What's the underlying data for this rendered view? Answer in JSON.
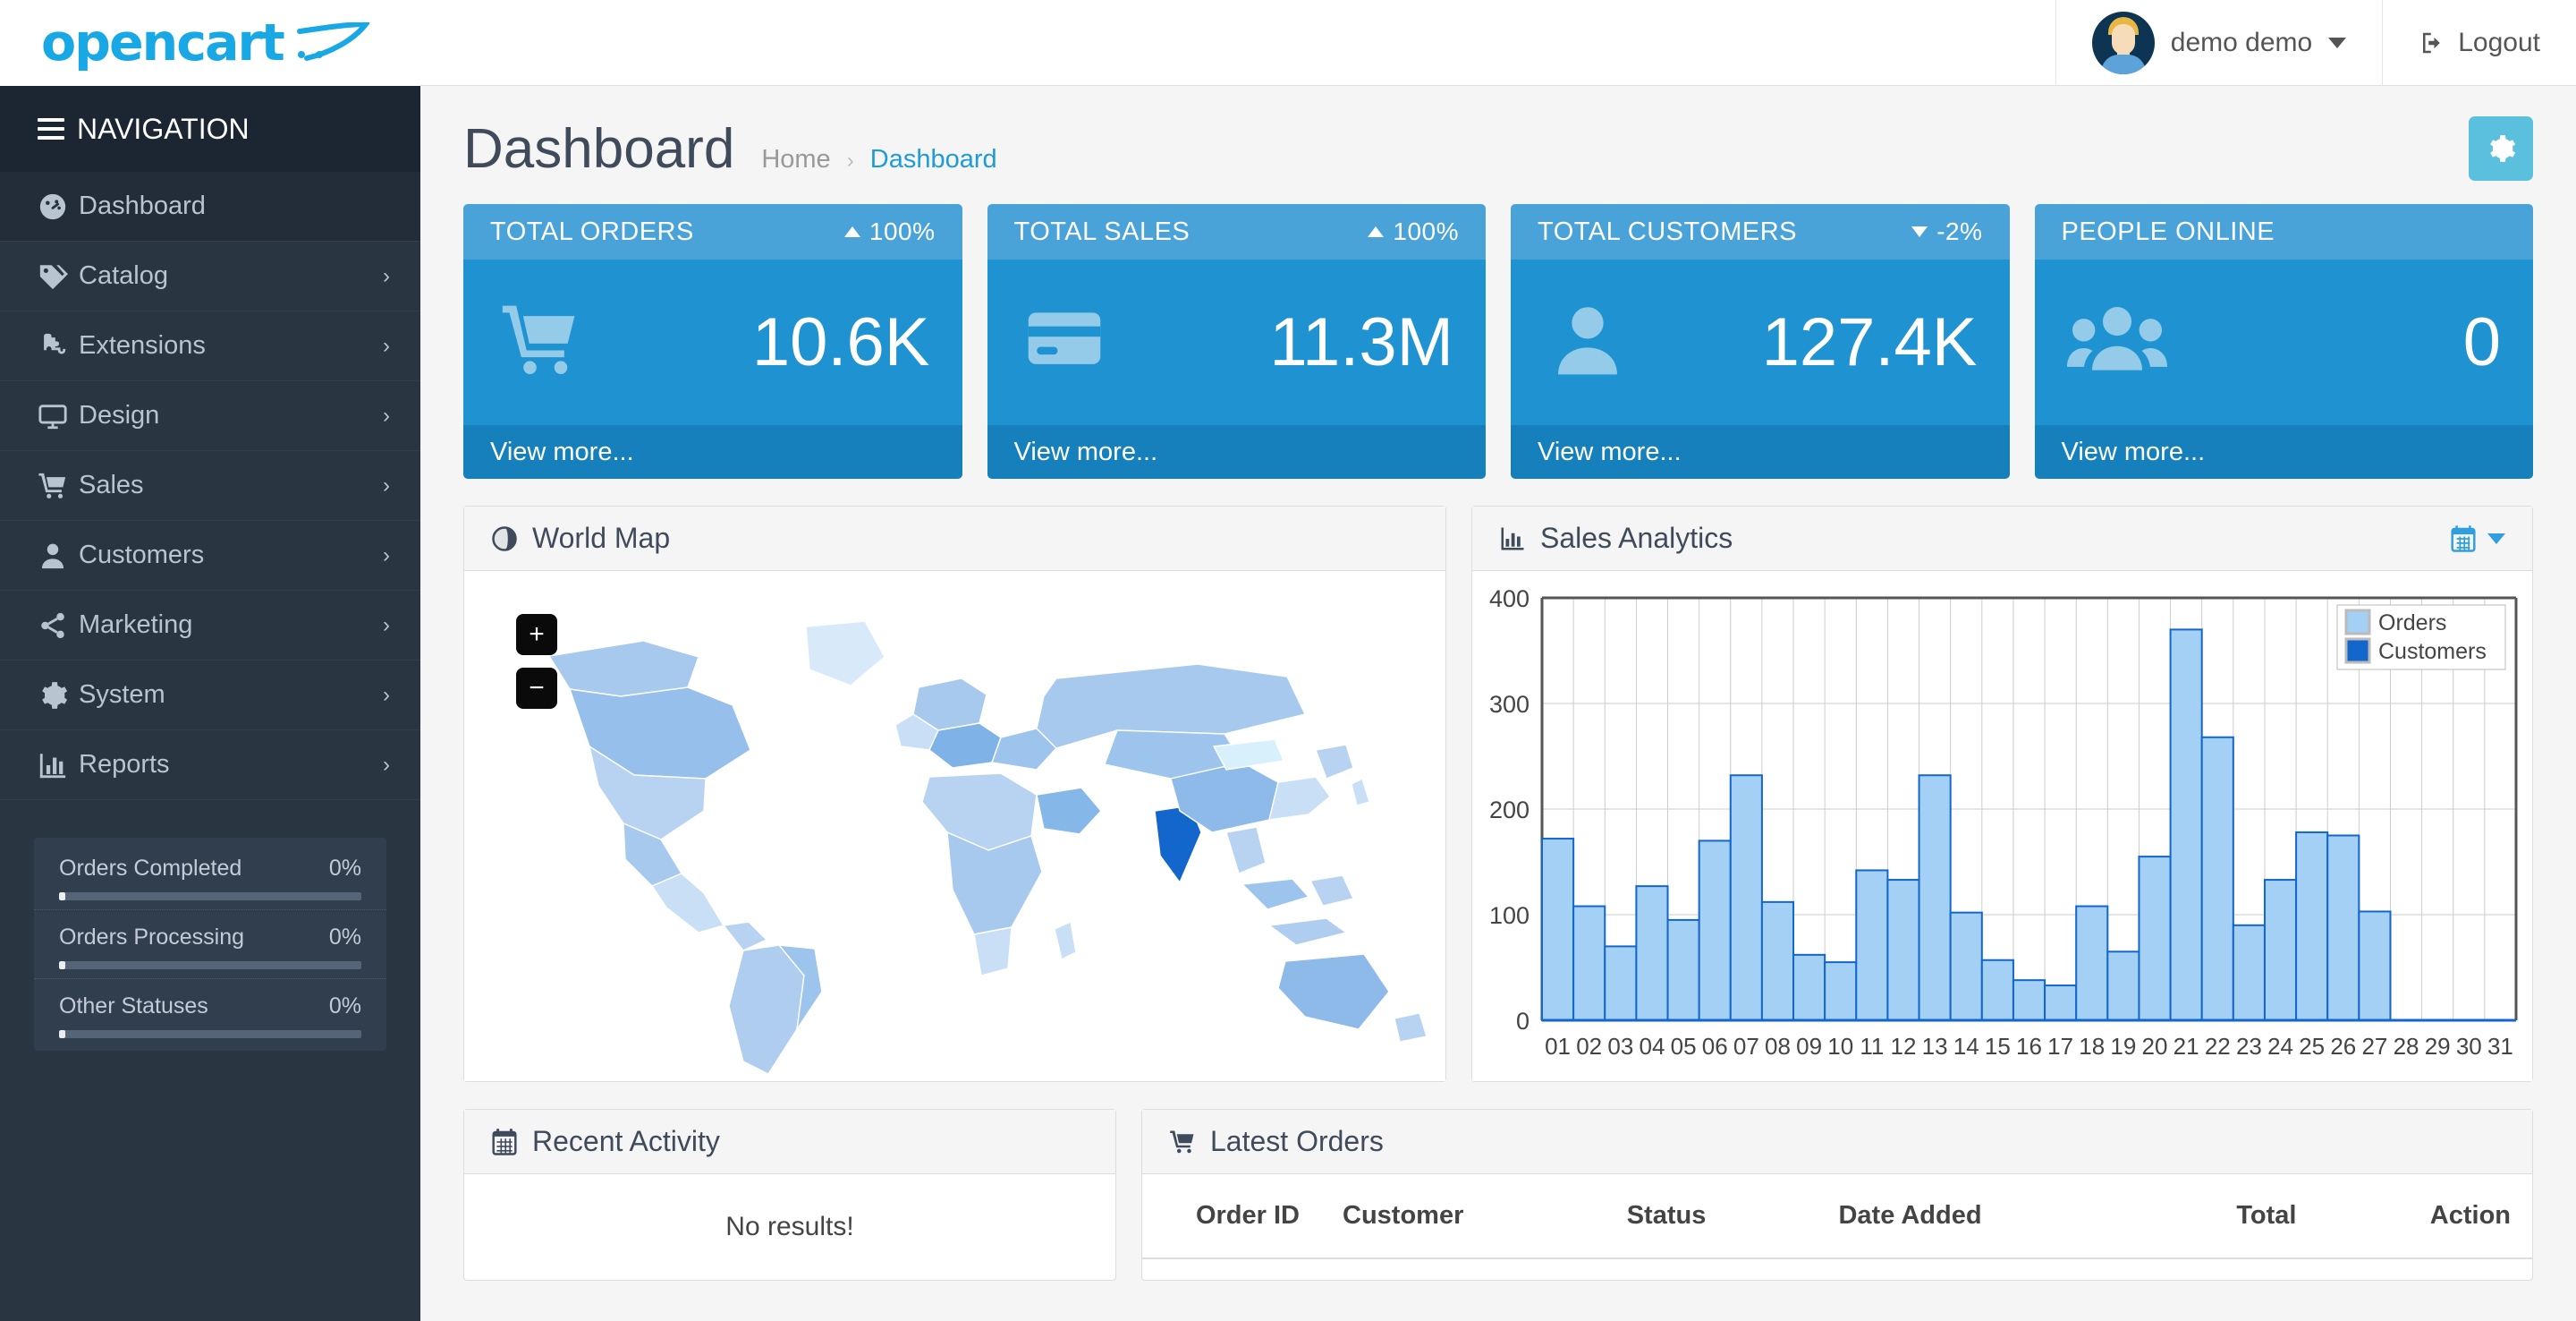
{
  "brand": {
    "logo_text": "opencart",
    "logo_icon": "shopping-cart-swoosh"
  },
  "sidebar": {
    "nav_header": "NAVIGATION",
    "items": [
      {
        "label": "Dashboard",
        "icon": "dashboard-gauge-icon",
        "has_caret": false,
        "active": true
      },
      {
        "label": "Catalog",
        "icon": "tag-icon",
        "has_caret": true,
        "active": false
      },
      {
        "label": "Extensions",
        "icon": "puzzle-piece-icon",
        "has_caret": true,
        "active": false
      },
      {
        "label": "Design",
        "icon": "monitor-icon",
        "has_caret": true,
        "active": false
      },
      {
        "label": "Sales",
        "icon": "shopping-cart-icon",
        "has_caret": true,
        "active": false
      },
      {
        "label": "Customers",
        "icon": "user-icon",
        "has_caret": true,
        "active": false
      },
      {
        "label": "Marketing",
        "icon": "share-nodes-icon",
        "has_caret": true,
        "active": false
      },
      {
        "label": "System",
        "icon": "gear-icon",
        "has_caret": true,
        "active": false
      },
      {
        "label": "Reports",
        "icon": "bar-chart-icon",
        "has_caret": true,
        "active": false
      }
    ],
    "stats": [
      {
        "label": "Orders Completed",
        "value": "0%",
        "percent": 0
      },
      {
        "label": "Orders Processing",
        "value": "0%",
        "percent": 0
      },
      {
        "label": "Other Statuses",
        "value": "0%",
        "percent": 0
      }
    ]
  },
  "topbar": {
    "user_name": "demo demo",
    "user_caret_icon": "chevron-down-icon",
    "avatar_icon": "avatar",
    "logout_label": "Logout",
    "logout_icon": "logout-icon"
  },
  "page": {
    "title": "Dashboard",
    "breadcrumb": {
      "home": "Home",
      "separator": "›",
      "current": "Dashboard"
    },
    "settings_icon": "gear-icon"
  },
  "cards": [
    {
      "title": "TOTAL ORDERS",
      "percent": "100%",
      "direction": "up",
      "value": "10.6K",
      "icon": "shopping-cart-icon",
      "footer": "View more..."
    },
    {
      "title": "TOTAL SALES",
      "percent": "100%",
      "direction": "up",
      "value": "11.3M",
      "icon": "credit-card-icon",
      "footer": "View more..."
    },
    {
      "title": "TOTAL CUSTOMERS",
      "percent": "-2%",
      "direction": "down",
      "value": "127.4K",
      "icon": "user-icon",
      "footer": "View more..."
    },
    {
      "title": "PEOPLE ONLINE",
      "percent": "",
      "direction": "none",
      "value": "0",
      "icon": "users-group-icon",
      "footer": "View more..."
    }
  ],
  "world_map": {
    "title": "World Map",
    "icon": "globe-icon",
    "zoom_in": "+",
    "zoom_out": "−"
  },
  "sales_analytics": {
    "title": "Sales Analytics",
    "icon": "bar-chart-icon",
    "calendar_icon": "calendar-icon",
    "caret_icon": "chevron-down-icon"
  },
  "recent_activity": {
    "title": "Recent Activity",
    "icon": "calendar-icon",
    "empty_text": "No results!"
  },
  "latest_orders": {
    "title": "Latest Orders",
    "icon": "shopping-cart-icon",
    "columns": [
      "Order ID",
      "Customer",
      "Status",
      "Date Added",
      "Total",
      "Action"
    ]
  },
  "colors": {
    "sidebar_bg": "#2a3542",
    "brand_blue": "#19a8e6",
    "card_body": "#1f93d2",
    "card_head": "#4aa3d8",
    "card_foot": "#1580bb",
    "gear_btn": "#5bc0de",
    "orders_series": "#a5d0f5",
    "customers_series": "#1266cc"
  },
  "chart_data": {
    "type": "bar",
    "title": "Sales Analytics",
    "xlabel": "",
    "ylabel": "",
    "ylim": [
      0,
      400
    ],
    "yticks": [
      0,
      100,
      200,
      300,
      400
    ],
    "grid": true,
    "legend_position": "top-right",
    "categories": [
      "01",
      "02",
      "03",
      "04",
      "05",
      "06",
      "07",
      "08",
      "09",
      "10",
      "11",
      "12",
      "13",
      "14",
      "15",
      "16",
      "17",
      "18",
      "19",
      "20",
      "21",
      "22",
      "23",
      "24",
      "25",
      "26",
      "27",
      "28",
      "29",
      "30",
      "31"
    ],
    "series": [
      {
        "name": "Orders",
        "color": "#a5d0f5",
        "values": [
          172,
          108,
          70,
          127,
          95,
          170,
          232,
          112,
          62,
          55,
          142,
          133,
          232,
          102,
          57,
          38,
          33,
          108,
          65,
          155,
          370,
          268,
          90,
          133,
          178,
          175,
          103,
          0,
          0,
          0,
          0
        ]
      },
      {
        "name": "Customers",
        "color": "#1266cc",
        "values": [
          0,
          0,
          0,
          0,
          0,
          0,
          0,
          0,
          0,
          0,
          0,
          0,
          0,
          0,
          0,
          0,
          0,
          0,
          0,
          0,
          0,
          0,
          0,
          0,
          0,
          0,
          0,
          0,
          0,
          0,
          0
        ]
      }
    ]
  }
}
